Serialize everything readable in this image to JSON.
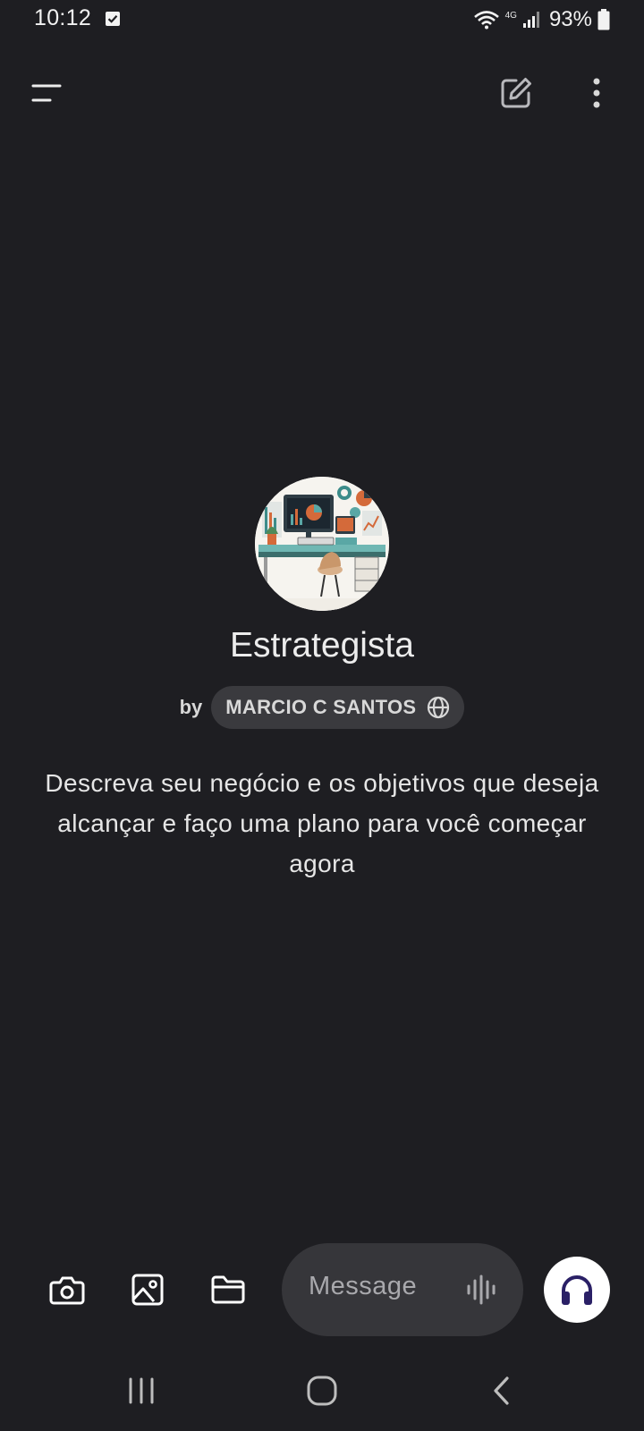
{
  "status_bar": {
    "time": "10:12",
    "network": "4G",
    "battery": "93%"
  },
  "top_bar": {
    "menu_icon": "menu-icon",
    "new_chat_icon": "new-chat-icon",
    "more_icon": "more-vert-icon"
  },
  "gpt": {
    "name": "Estrategista",
    "by_label": "by",
    "author": "MARCIO C SANTOS",
    "author_icon": "globe-icon",
    "description": "Descreva seu negócio e os objetivos que deseja alcançar e faço uma plano para você começar agora"
  },
  "composer": {
    "camera_icon": "camera-icon",
    "photo_icon": "image-icon",
    "file_icon": "folder-icon",
    "placeholder": "Message",
    "dictate_icon": "waveform-icon",
    "voice_mode_icon": "headphones-icon"
  },
  "nav_bar": {
    "recents_icon": "recents-icon",
    "home_icon": "home-icon",
    "back_icon": "back-icon"
  },
  "colors": {
    "background": "#1e1e22",
    "pill": "#36363a",
    "chip": "#3a3a3e",
    "voice_button_bg": "#ffffff",
    "voice_icon": "#2a2066"
  }
}
